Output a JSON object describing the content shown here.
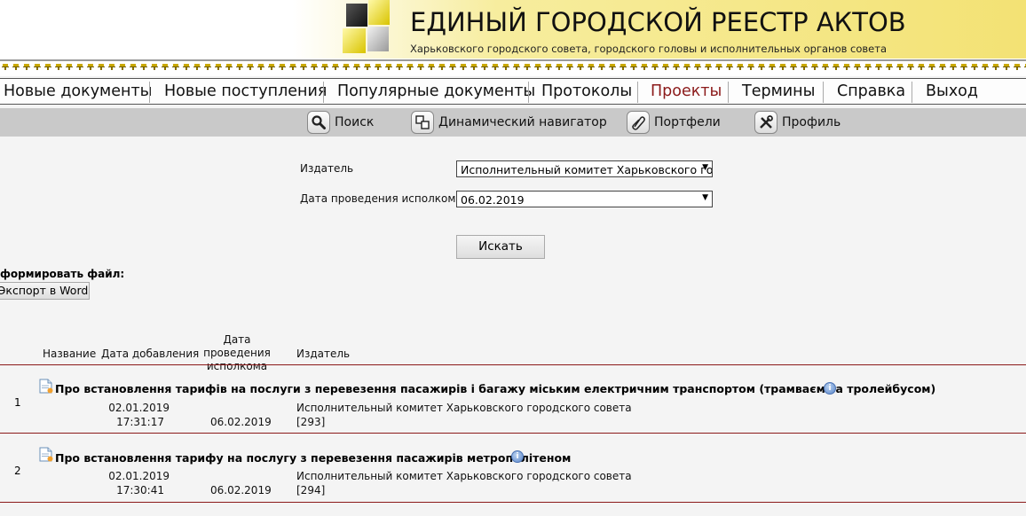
{
  "header": {
    "title": "ЕДИНЫЙ ГОРОДСКОЙ РЕЕСТР АКТОВ",
    "subtitle": "Харьковского городского совета, городского головы и исполнительных органов совета"
  },
  "main_nav": [
    {
      "label": "Новые документы",
      "active": false
    },
    {
      "label": "Новые поступления",
      "active": false
    },
    {
      "label": "Популярные документы",
      "active": false
    },
    {
      "label": "Протоколы",
      "active": false
    },
    {
      "label": "Проекты",
      "active": true
    },
    {
      "label": "Термины",
      "active": false
    },
    {
      "label": "Справка",
      "active": false
    },
    {
      "label": "Выход",
      "active": false
    }
  ],
  "sub_nav": [
    {
      "label": "Поиск",
      "icon": "magnifier-icon"
    },
    {
      "label": "Динамический навигатор",
      "icon": "navigator-icon"
    },
    {
      "label": "Портфели",
      "icon": "paperclip-icon"
    },
    {
      "label": "Профиль",
      "icon": "tools-icon"
    }
  ],
  "form": {
    "publisher_label": "Издатель",
    "publisher_value": "Исполнительный комитет Харьковского городского совета",
    "date_label": "Дата проведения исполкома",
    "date_value": "06.02.2019",
    "search_button": "Искать"
  },
  "export": {
    "title": "формировать файл:",
    "word_button": "Экспорт в Word"
  },
  "table": {
    "headers": {
      "name": "Название",
      "date_added": "Дата добавления",
      "meeting_date": "Дата проведения исполкома",
      "publisher": "Издатель"
    },
    "rows": [
      {
        "num": "1",
        "title": "Про встановлення тарифів на послуги з перевезення пасажирів і багажу міським електричним транспортом (трамваєм та тролейбусом)",
        "added_date": "02.01.2019",
        "added_time": "17:31:17",
        "meeting_date": "06.02.2019",
        "publisher": "Исполнительный комитет Харьковского городского совета",
        "reg": "[293]"
      },
      {
        "num": "2",
        "title": "Про встановлення тарифу на послугу з перевезення пасажирів метрополітеном",
        "added_date": "02.01.2019",
        "added_time": "17:30:41",
        "meeting_date": "06.02.2019",
        "publisher": "Исполнительный комитет Харьковского городского совета",
        "reg": "[294]"
      }
    ]
  },
  "colors": {
    "active_nav": "#8b1a1a",
    "row_separator": "#8b1a1a",
    "header_gold": "#f3e274"
  }
}
